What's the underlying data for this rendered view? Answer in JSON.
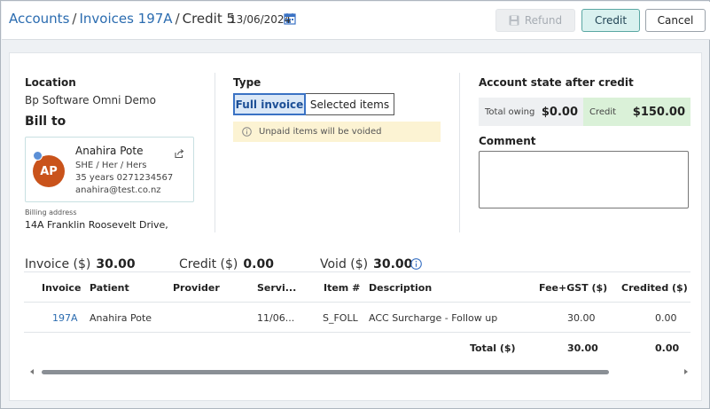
{
  "header": {
    "breadcrumb": [
      {
        "label": "Accounts",
        "link": true
      },
      {
        "label": "Invoices 197A",
        "link": true
      },
      {
        "label": "Credit 5",
        "link": false
      }
    ],
    "separator": "/",
    "date": "13/06/2024",
    "refund_label": "Refund",
    "credit_label": "Credit",
    "cancel_label": "Cancel"
  },
  "location": {
    "heading": "Location",
    "value": "Bp Software Omni Demo"
  },
  "bill_to": {
    "heading": "Bill to",
    "initials": "AP",
    "name": "Anahira Pote",
    "pronouns": "SHE / Her / Hers",
    "age_phone": "35 years  0271234567",
    "email": "anahira@test.co.nz",
    "billing_label": "Billing address",
    "billing_address": "14A Franklin Roosevelt Drive,"
  },
  "type": {
    "heading": "Type",
    "options": [
      "Full invoice",
      "Selected items"
    ],
    "selected": "Full invoice",
    "notice": "Unpaid items will be voided"
  },
  "account_state": {
    "heading": "Account state after credit",
    "owing_label": "Total owing",
    "owing_value": "$0.00",
    "credit_label": "Credit",
    "credit_value": "$150.00",
    "comment_label": "Comment",
    "comment_value": ""
  },
  "totals": {
    "invoice_label": "Invoice ($)",
    "invoice_value": "30.00",
    "credit_label": "Credit ($)",
    "credit_value": "0.00",
    "void_label": "Void ($)",
    "void_value": "30.00"
  },
  "table": {
    "columns": [
      "Invoice",
      "Patient",
      "Provider",
      "Servi...",
      "Item #",
      "Description",
      "Fee+GST ($)",
      "Credited ($)"
    ],
    "rows": [
      {
        "invoice": "197A",
        "patient": "Anahira Pote",
        "provider": "",
        "service": "11/06...",
        "item": "S_FOLL",
        "description": "ACC Surcharge - Follow up",
        "fee": "30.00",
        "credited": "0.00"
      }
    ],
    "footer": {
      "label": "Total ($)",
      "fee": "30.00",
      "credited": "0.00"
    }
  },
  "colors": {
    "link": "#2b6cb0",
    "credit_button_bg": "#d9f1ef",
    "credit_tile_bg": "#daf1d8",
    "notice_bg": "#fcf3d3",
    "avatar_bg": "#c9531b",
    "selected_toggle": "#3a72c4"
  },
  "icons": {
    "date_picker": "calendar-icon",
    "refund": "save-icon",
    "share": "share-icon",
    "notice": "info-icon",
    "void_info": "info-icon"
  }
}
